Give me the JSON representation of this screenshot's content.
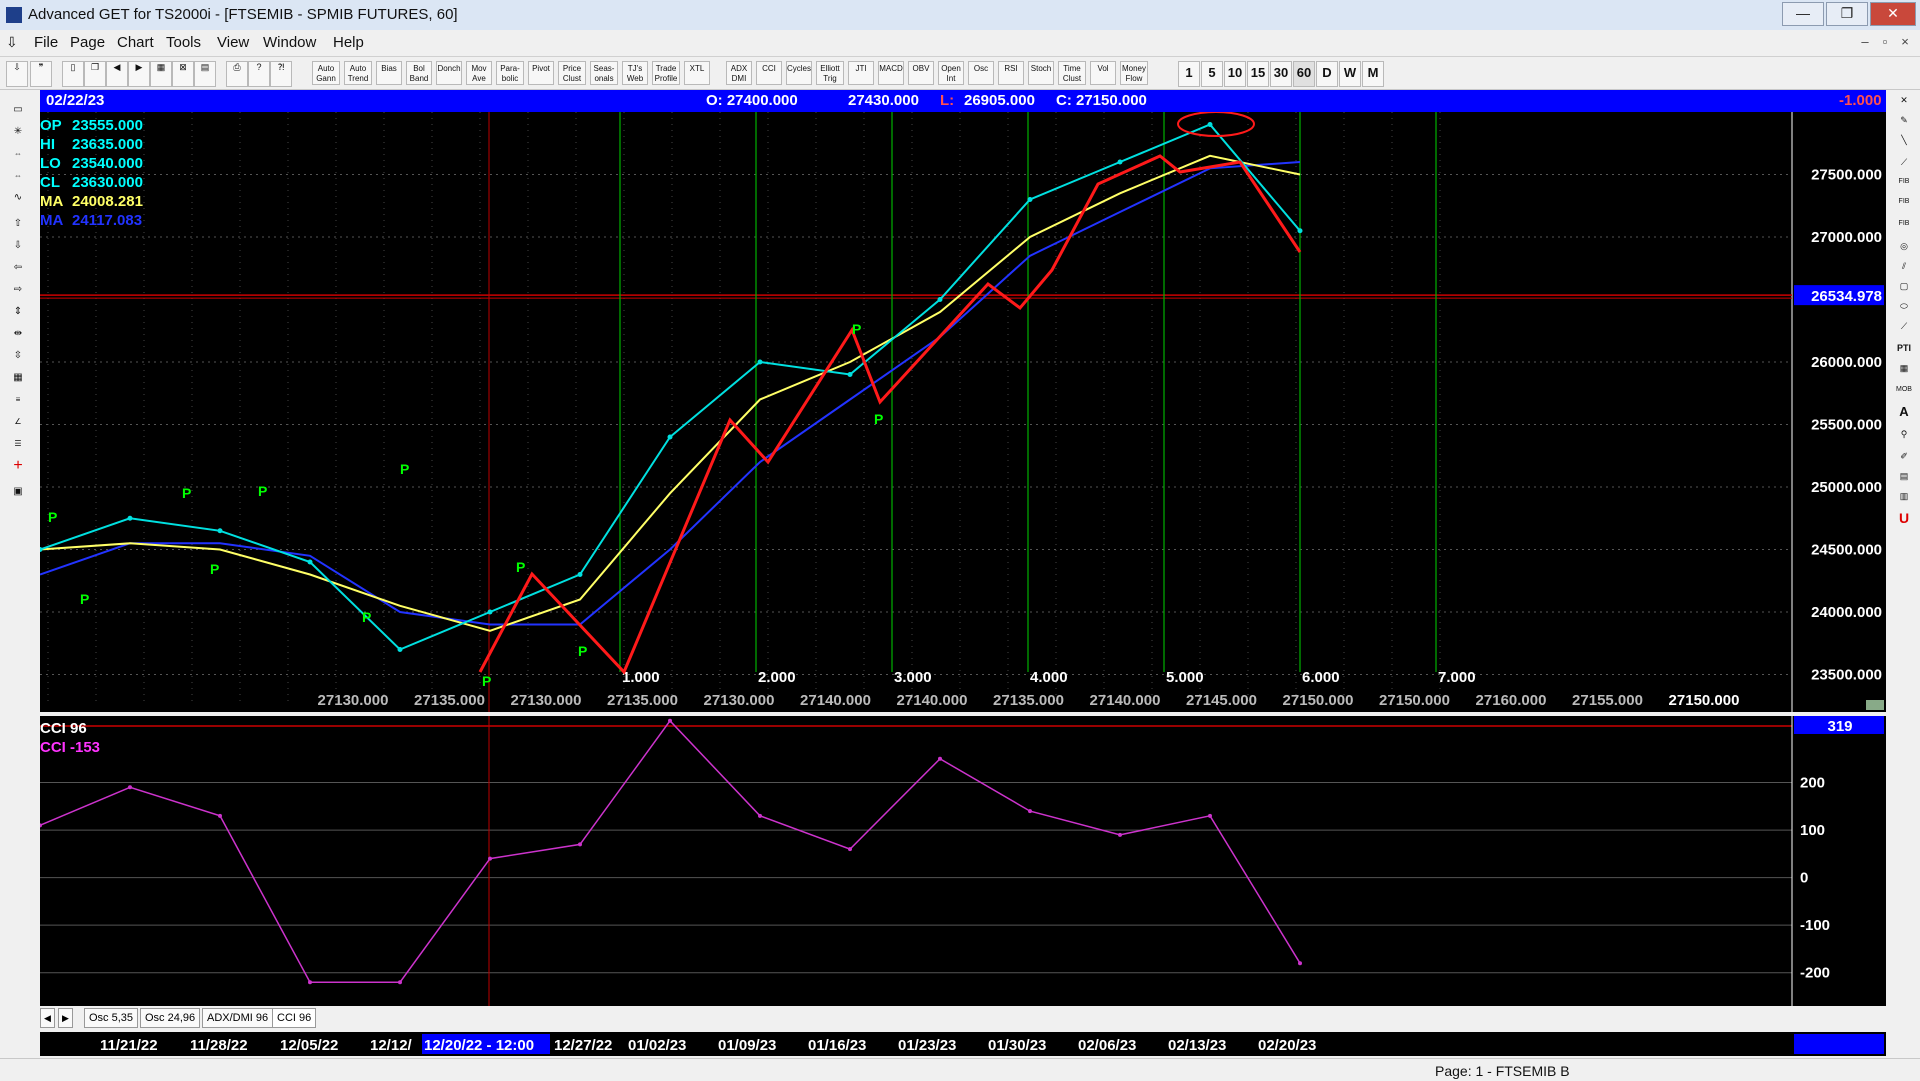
{
  "window": {
    "title": "Advanced GET for TS2000i - [FTSEMIB - SPMIB FUTURES, 60]",
    "controls": [
      "—",
      "❐",
      "✕"
    ]
  },
  "menu": {
    "items": [
      "File",
      "Page",
      "Chart",
      "Tools",
      "View",
      "Window",
      "Help"
    ],
    "mdi_controls": [
      "–",
      "▫",
      "×"
    ]
  },
  "toolbar": {
    "study_buttons": [
      "Auto Gann",
      "Auto Trend",
      "Bias",
      "Bol Band",
      "Donch",
      "Mov Ave",
      "Para- bolic",
      "Pivot",
      "Price Clust",
      "Seas- onals",
      "TJ's Web",
      "Trade Profile",
      "XTL",
      "ADX DMI",
      "CCI",
      "Cycles",
      "Elliott Trig",
      "JTI",
      "MACD",
      "OBV",
      "Open Int",
      "Osc",
      "RSI",
      "Stoch",
      "Time Clust",
      "Vol",
      "Money Flow"
    ],
    "interval_buttons": [
      "1",
      "5",
      "10",
      "15",
      "30",
      "60",
      "D",
      "W",
      "M"
    ]
  },
  "price_bar": {
    "date": "02/22/23",
    "open": "O: 27400.000",
    "high": "27430.000",
    "low_label": "L:",
    "low": "26905.000",
    "close": "C: 27150.000",
    "change": "-1.000"
  },
  "overlay_values": [
    {
      "label": "OP",
      "value": "23555.000",
      "color": "#00ffff"
    },
    {
      "label": "HI",
      "value": "23635.000",
      "color": "#00ffff"
    },
    {
      "label": "LO",
      "value": "23540.000",
      "color": "#00ffff"
    },
    {
      "label": "CL",
      "value": "23630.000",
      "color": "#00ffff"
    },
    {
      "label": "MA",
      "value": "24008.281",
      "color": "#ffff66"
    },
    {
      "label": "MA",
      "value": "24117.083",
      "color": "#2233ff"
    }
  ],
  "y_axis_labels": [
    "27500.000",
    "27000.000",
    "26000.000",
    "25500.000",
    "25000.000",
    "24500.000",
    "24000.000",
    "23500.000"
  ],
  "current_price_marker": "26534.978",
  "time_cycle_labels": [
    "1.000",
    "2.000",
    "3.000",
    "4.000",
    "5.000",
    "6.000",
    "7.000"
  ],
  "time_projection_labels": [
    "27130.000",
    "27135.000",
    "27130.000",
    "27135.000",
    "27130.000",
    "27140.000",
    "27140.000",
    "27135.000",
    "27140.000",
    "27145.000",
    "27150.000",
    "27150.000",
    "27160.000",
    "27155.000",
    "27150.000"
  ],
  "pivot_marker": "P",
  "cci_panel": {
    "title": "CCI 96",
    "value_label": "CCI  -153",
    "marker_value": "319",
    "axis_labels": [
      "200",
      "100",
      "0",
      "-100",
      "-200"
    ]
  },
  "oscillator_tabs": [
    "Osc 5,35",
    "Osc 24,96",
    "ADX/DMI 96",
    "CCI 96"
  ],
  "date_axis": {
    "labels": [
      "11/21/22",
      "11/28/22",
      "12/05/22",
      "12/12/",
      "12/20/22 - 12:00",
      "12/27/22",
      "01/02/23",
      "01/09/23",
      "01/16/23",
      "01/23/23",
      "01/30/23",
      "02/06/23",
      "02/13/23",
      "02/20/23"
    ],
    "highlighted": "12/20/22 - 12:00"
  },
  "status": {
    "text": "Page: 1 - FTSEMIB B"
  },
  "colors": {
    "price_line": "#00e0e0",
    "ma_fast": "#ffff66",
    "ma_slow": "#2233ff",
    "trend_lines": "#ff1a1a",
    "cycle_lines": "#00b000",
    "pivot_labels": "#00ff00",
    "cci_line": "#cc33cc",
    "header_blue": "#0000ff"
  },
  "chart_data": [
    {
      "type": "line",
      "title": "FTSEMIB - SPMIB FUTURES, 60",
      "xlabel": "",
      "ylabel": "",
      "ylim": [
        23200,
        28000
      ],
      "x": [
        "11/21/22",
        "11/28/22",
        "12/05/22",
        "12/12/22",
        "12/20/22",
        "12/27/22",
        "01/02/23",
        "01/09/23",
        "01/16/23",
        "01/23/23",
        "01/30/23",
        "02/06/23",
        "02/13/23",
        "02/20/23",
        "02/22/23"
      ],
      "series": [
        {
          "values": [
            24500,
            24750,
            24650,
            24400,
            23700,
            24000,
            24300,
            25400,
            26000,
            25900,
            26500,
            27300,
            27600,
            27900,
            27050
          ]
        },
        {
          "values": [
            24500,
            24550,
            24500,
            24300,
            24050,
            23850,
            24100,
            24950,
            25700,
            26000,
            26400,
            27000,
            27350,
            27650,
            27500
          ]
        },
        {
          "values": [
            24300,
            24550,
            24550,
            24450,
            24000,
            23900,
            23900,
            24500,
            25200,
            25700,
            26200,
            26850,
            27200,
            27550,
            27600
          ]
        }
      ],
      "grid": true,
      "legend": "top-left"
    },
    {
      "type": "line",
      "title": "CCI 96",
      "ylim": [
        -270,
        340
      ],
      "x": [
        "11/21/22",
        "11/28/22",
        "12/05/22",
        "12/12/22",
        "12/20/22",
        "12/27/22",
        "01/02/23",
        "01/09/23",
        "01/16/23",
        "01/23/23",
        "01/30/23",
        "02/06/23",
        "02/13/23",
        "02/20/23",
        "02/22/23"
      ],
      "series": [
        {
          "values": [
            110,
            190,
            130,
            -220,
            -220,
            40,
            70,
            330,
            130,
            60,
            250,
            140,
            90,
            130,
            -180
          ]
        }
      ],
      "grid": true,
      "legend": "top-left"
    }
  ]
}
